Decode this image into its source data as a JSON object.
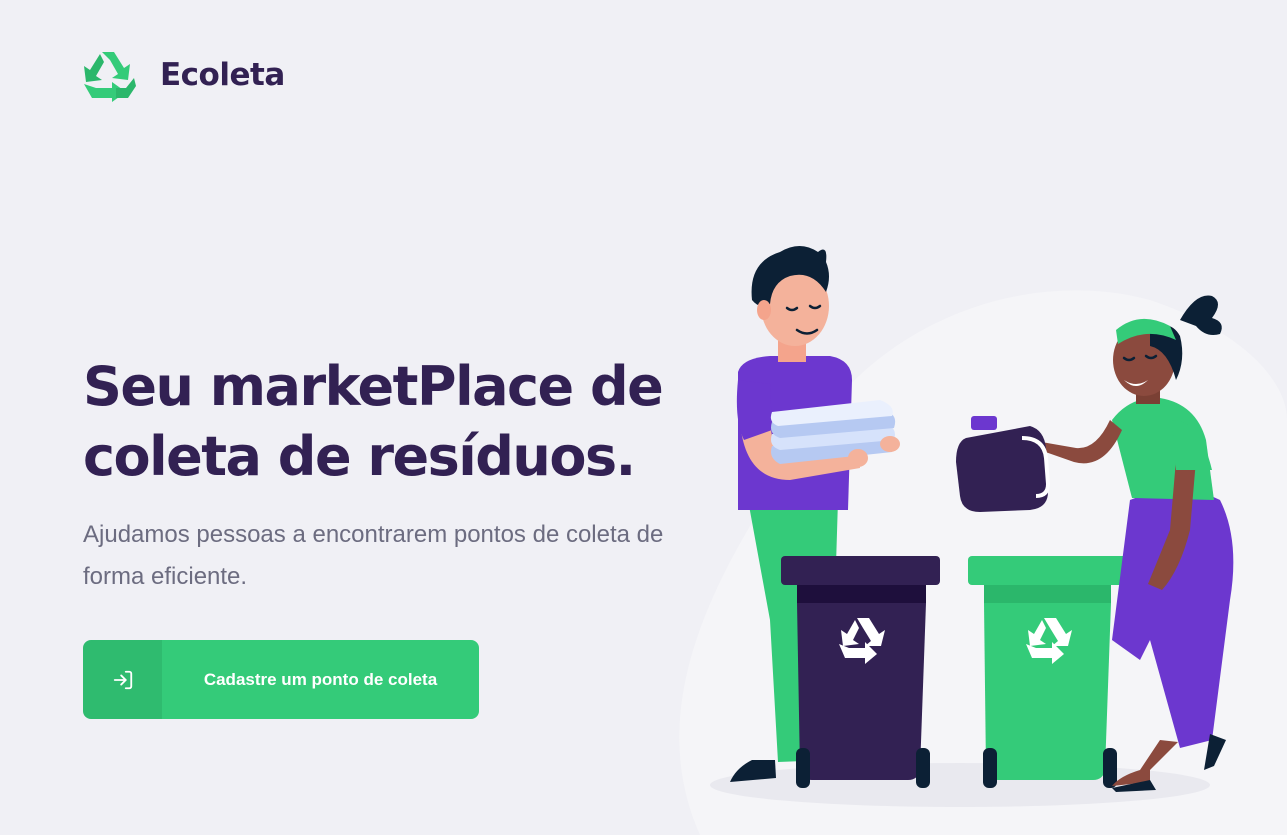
{
  "app": {
    "name": "Ecoleta"
  },
  "hero": {
    "title": "Seu marketPlace de coleta de resíduos.",
    "description": "Ajudamos pessoas a encontrarem pontos de coleta de forma eficiente."
  },
  "cta": {
    "label": "Cadastre um ponto de coleta",
    "icon": "log-in-icon"
  },
  "colors": {
    "background": "#F0F0F5",
    "title": "#322153",
    "text": "#6C6C80",
    "accent": "#34CB79",
    "purple": "#6C37CF"
  },
  "illustration": {
    "icon": "recycling-illustration"
  }
}
